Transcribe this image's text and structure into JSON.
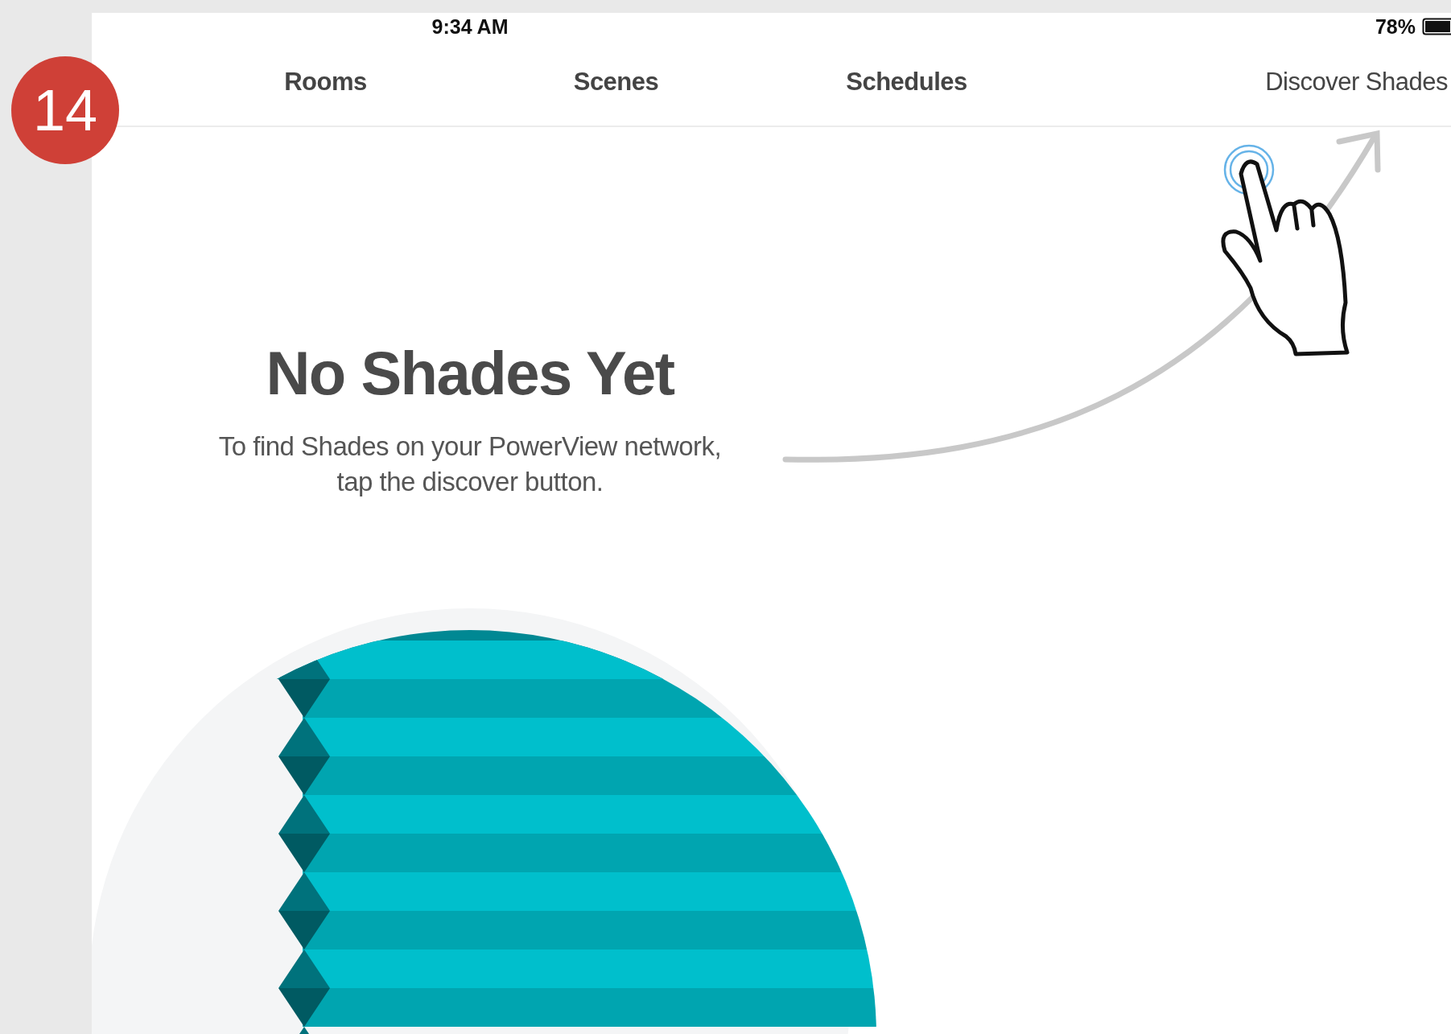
{
  "status_bar": {
    "time": "9:34 AM",
    "battery": "78%"
  },
  "tabs": [
    {
      "label": "Rooms",
      "kind": "tab"
    },
    {
      "label": "Scenes",
      "kind": "tab"
    },
    {
      "label": "Schedules",
      "kind": "tab"
    },
    {
      "label": "Discover Shades",
      "kind": "action"
    }
  ],
  "step_badge": "14",
  "empty_state": {
    "title": "No Shades Yet",
    "message_lines": [
      "To find Shades on your PowerView network,",
      "tap the discover button."
    ]
  }
}
